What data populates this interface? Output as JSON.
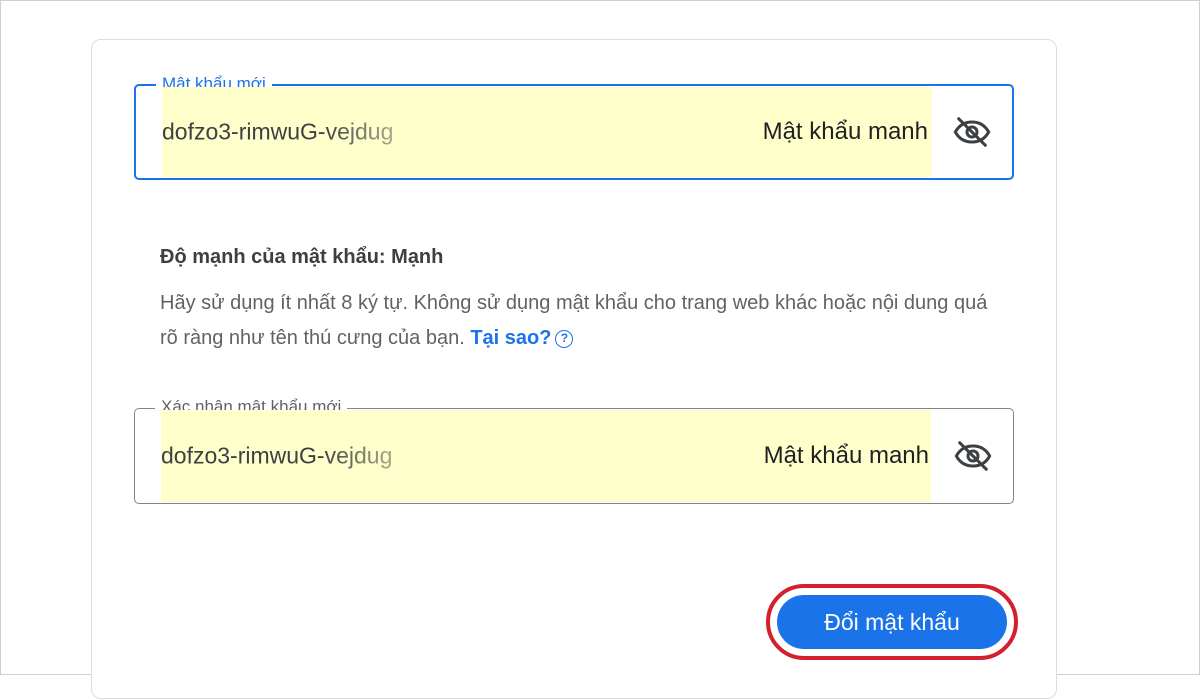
{
  "form": {
    "new_password": {
      "label": "Mật khẩu mới",
      "value": "dofzo3-rimwuG-vejdug",
      "strength_tag": "Mật khẩu manh",
      "icon": "eye-off-icon"
    },
    "strength": {
      "title": "Độ mạnh của mật khẩu: Mạnh",
      "help_text": "Hãy sử dụng ít nhất 8 ký tự. Không sử dụng mật khẩu cho trang web khác hoặc nội dung quá rõ ràng như tên thú cưng của bạn.",
      "why_link": "Tại sao?",
      "help_icon": "?"
    },
    "confirm_password": {
      "label": "Xác nhận mật khẩu mới",
      "value": "dofzo3-rimwuG-vejdug",
      "strength_tag": "Mật khẩu manh",
      "icon": "eye-off-icon"
    },
    "submit_label": "Đổi mật khẩu"
  },
  "colors": {
    "accent": "#1a73e8",
    "autofill_highlight": "#ffffcc",
    "annotation_ring": "#d4202c"
  }
}
